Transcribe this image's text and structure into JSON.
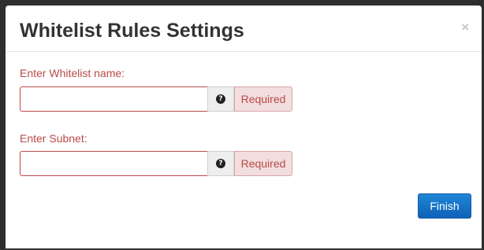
{
  "modal": {
    "title": "Whitelist Rules Settings",
    "close_symbol": "×"
  },
  "fields": [
    {
      "label": "Enter Whitelist name:",
      "value": "",
      "help_icon": "question-circle-icon",
      "help_symbol": "?",
      "status": "Required"
    },
    {
      "label": "Enter Subnet:",
      "value": "",
      "help_icon": "question-circle-icon",
      "help_symbol": "?",
      "status": "Required"
    }
  ],
  "footer": {
    "finish_label": "Finish"
  },
  "colors": {
    "error": "#b94a48",
    "error_bg": "#f2dede",
    "primary": "#0f62b8"
  }
}
